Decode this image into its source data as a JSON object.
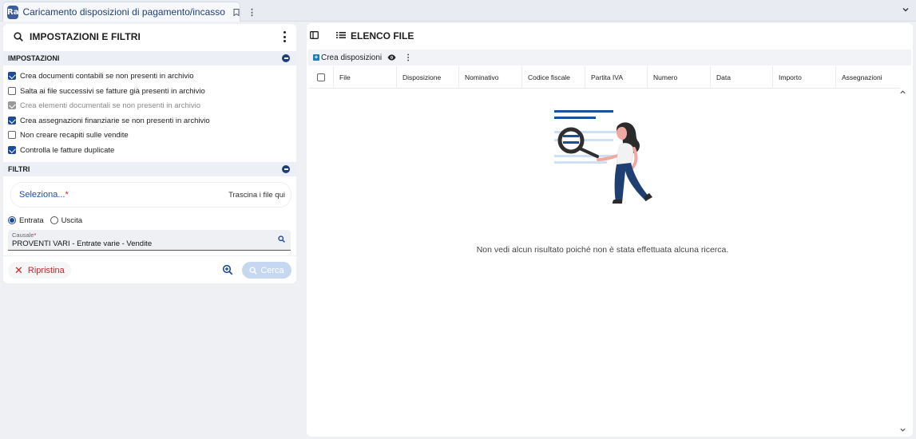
{
  "tab": {
    "logo": "Ra",
    "title": "Caricamento disposizioni di pagamento/incasso"
  },
  "left_panel": {
    "title": "IMPOSTAZIONI E FILTRI",
    "settings": {
      "title": "IMPOSTAZIONI",
      "items": [
        {
          "label": "Crea documenti contabili se non presenti in archivio",
          "checked": true,
          "disabled": false
        },
        {
          "label": "Salta ai file successivi se fatture già presenti in archivio",
          "checked": false,
          "disabled": false
        },
        {
          "label": "Crea elementi documentali se non presenti in archivio",
          "checked": true,
          "disabled": true
        },
        {
          "label": "Crea assegnazioni finanziarie se non presenti in archivio",
          "checked": true,
          "disabled": false
        },
        {
          "label": "Non creare recapiti sulle vendite",
          "checked": false,
          "disabled": false
        },
        {
          "label": "Controlla le fatture duplicate",
          "checked": true,
          "disabled": false
        }
      ]
    },
    "filters": {
      "title": "FILTRI",
      "file_select": "Seleziona...",
      "required_mark": "*",
      "drop_hint": "Trascina i file qui",
      "radio": [
        {
          "label": "Entrata",
          "selected": true
        },
        {
          "label": "Uscita",
          "selected": false
        }
      ],
      "causale": {
        "label": "Causale",
        "value": "PROVENTI VARI - Entrate varie - Vendite"
      }
    },
    "actions": {
      "reset": "Ripristina",
      "search": "Cerca"
    }
  },
  "right_panel": {
    "title": "ELENCO FILE",
    "toolbar": {
      "create": "Crea disposizioni"
    },
    "columns": [
      "File",
      "Disposizione",
      "Nominativo",
      "Codice fiscale",
      "Partita IVA",
      "Numero",
      "Data",
      "Importo",
      "Assegnazioni"
    ],
    "empty_message": "Non vedi alcun risultato poiché non è stata effettuata alcuna ricerca."
  },
  "colors": {
    "primary": "#1d4b9c",
    "danger": "#c62828",
    "illustration_blue": "#1a4f9c",
    "illustration_light": "#cfe0f5",
    "background": "#eef0f4"
  }
}
